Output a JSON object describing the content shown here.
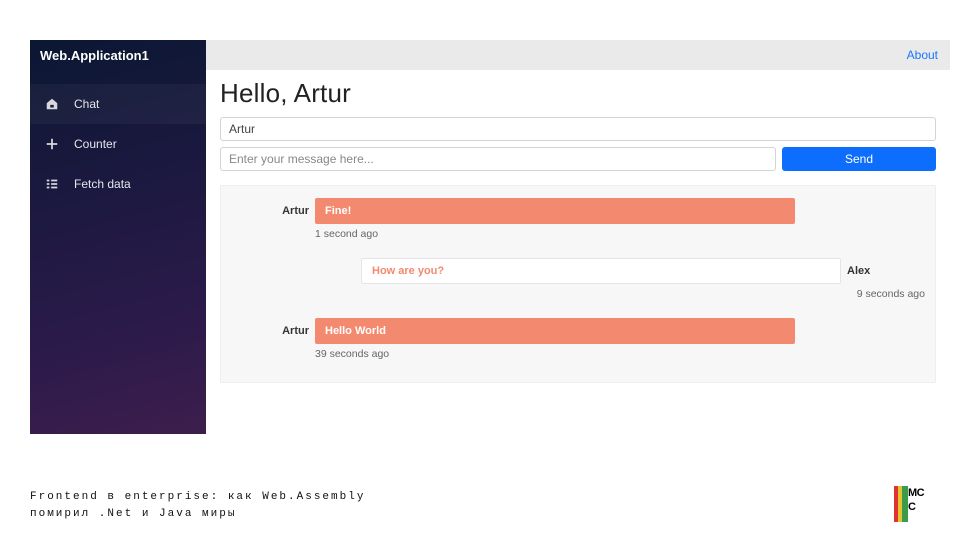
{
  "brand": "Web.Application1",
  "topbar": {
    "about": "About"
  },
  "sidebar": {
    "items": [
      {
        "label": "Chat"
      },
      {
        "label": "Counter"
      },
      {
        "label": "Fetch data"
      }
    ]
  },
  "page": {
    "title": "Hello, Artur"
  },
  "form": {
    "name_value": "Artur",
    "msg_placeholder": "Enter your message here...",
    "send_label": "Send"
  },
  "messages": [
    {
      "author": "Artur",
      "side": "left",
      "text": "Fine!",
      "ts": "1 second ago"
    },
    {
      "author": "Alex",
      "side": "right",
      "text": "How are you?",
      "ts": "9 seconds ago"
    },
    {
      "author": "Artur",
      "side": "left",
      "text": "Hello World",
      "ts": "39 seconds ago"
    }
  ],
  "footer": {
    "line1": "Frontend в enterprise: как Web.Assembly",
    "line2": "помирил .Net и Java миры"
  },
  "logo": {
    "top": "MC",
    "bottom": "C"
  }
}
